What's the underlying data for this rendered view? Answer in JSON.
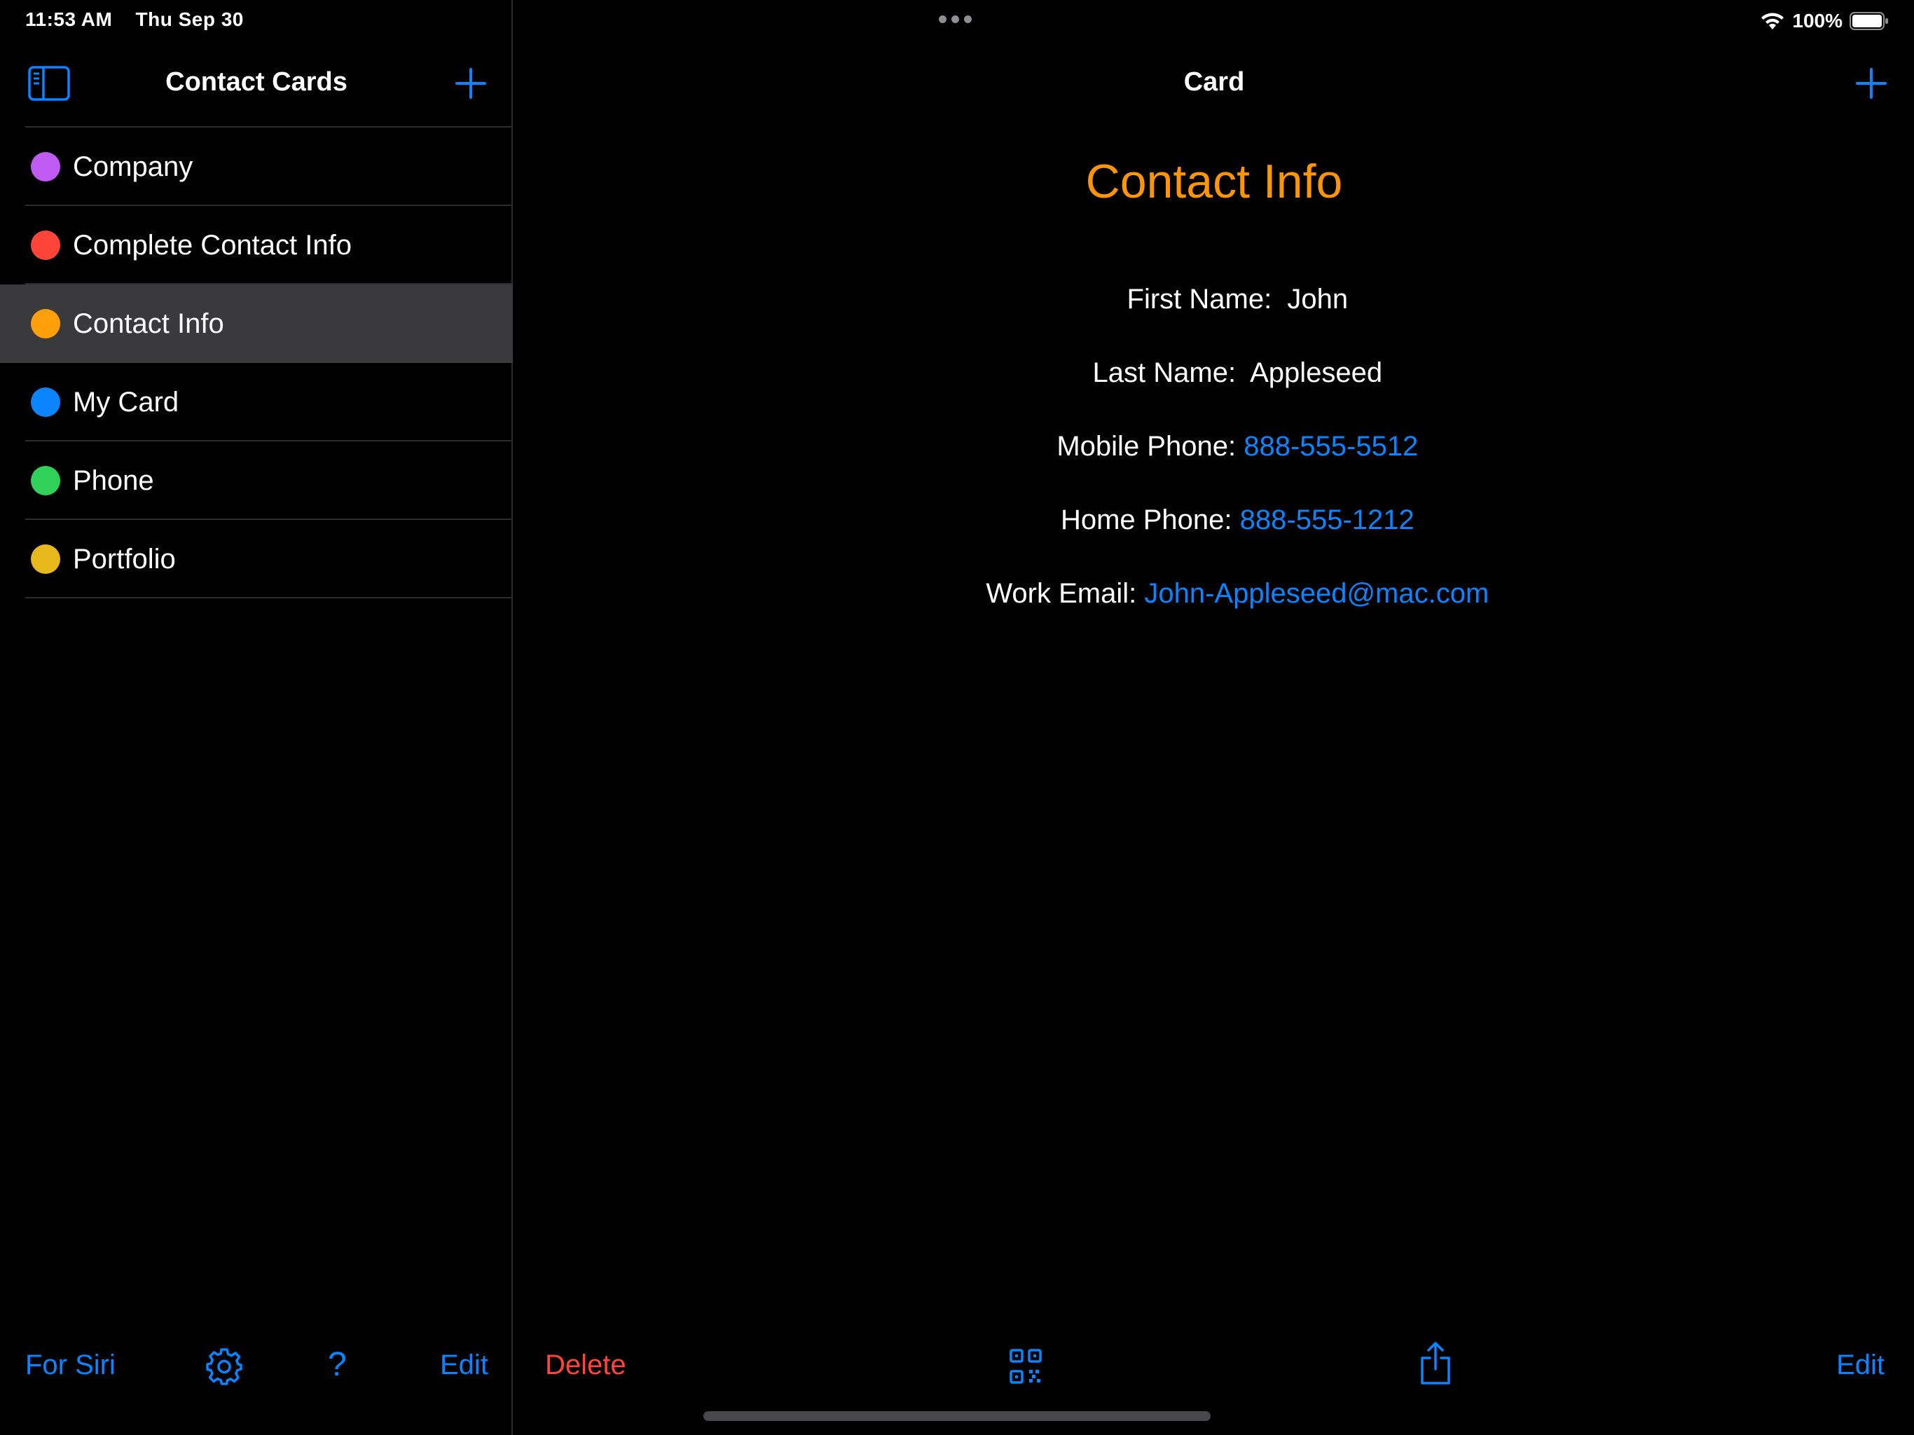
{
  "status_bar": {
    "time": "11:53 AM",
    "date": "Thu Sep 30",
    "battery": "100%",
    "wifi_icon": "wifi-icon",
    "battery_icon": "battery-full-icon"
  },
  "sidebar": {
    "title": "Contact Cards",
    "toggle_icon": "sidebar-toggle-icon",
    "add_icon": "plus-icon",
    "items": [
      {
        "label": "Company",
        "color": "#bf5af2",
        "selected": false
      },
      {
        "label": "Complete Contact Info",
        "color": "#ff453a",
        "selected": false
      },
      {
        "label": "Contact Info",
        "color": "#ff9f0a",
        "selected": true
      },
      {
        "label": "My Card",
        "color": "#0a84ff",
        "selected": false
      },
      {
        "label": "Phone",
        "color": "#30d158",
        "selected": false
      },
      {
        "label": "Portfolio",
        "color": "#e6b81c",
        "selected": false
      }
    ],
    "toolbar": {
      "for_siri": "For Siri",
      "settings_icon": "gear-icon",
      "help": "?",
      "edit": "Edit"
    }
  },
  "detail": {
    "title": "Card",
    "add_icon": "plus-icon",
    "heading": "Contact Info",
    "fields": [
      {
        "label": "First Name:  ",
        "value": "John",
        "is_link": false
      },
      {
        "label": "Last Name:  ",
        "value": "Appleseed",
        "is_link": false
      },
      {
        "label": "Mobile Phone: ",
        "value": "888-555-5512",
        "is_link": true
      },
      {
        "label": "Home Phone: ",
        "value": "888-555-1212",
        "is_link": true
      },
      {
        "label": "Work Email: ",
        "value": "John-Appleseed@mac.com",
        "is_link": true
      }
    ],
    "toolbar": {
      "delete": "Delete",
      "qr_icon": "qr-code-icon",
      "share_icon": "share-icon",
      "edit": "Edit"
    }
  },
  "colors": {
    "accent": "#0a84ff",
    "heading": "#ff9500",
    "destructive": "#ff453a",
    "background": "#000000",
    "selection": "#3a3a3c"
  }
}
